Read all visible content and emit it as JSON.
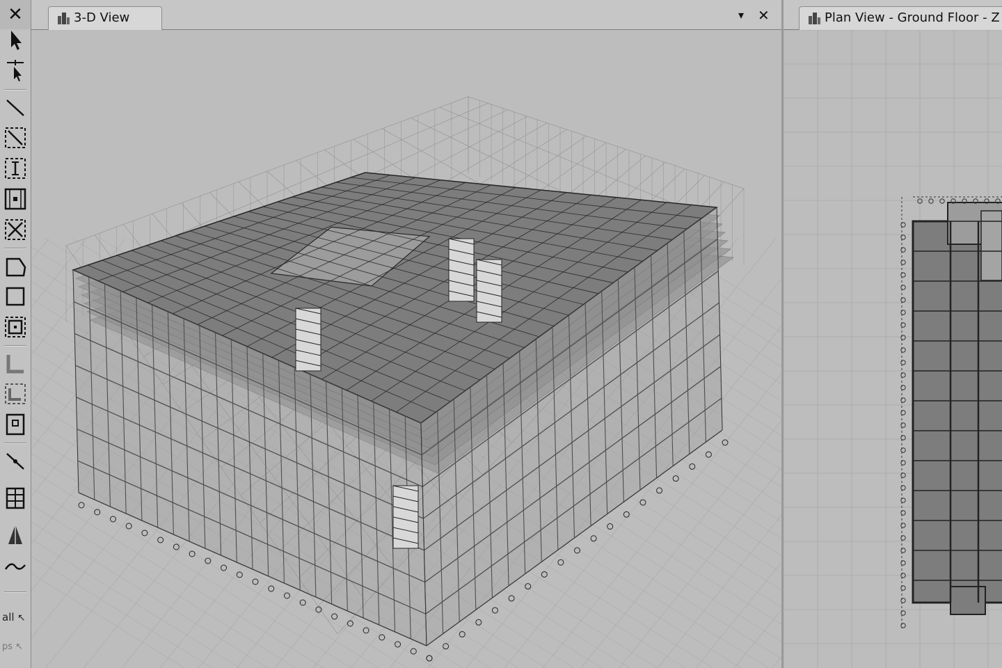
{
  "toolbar": {
    "close_glyph": "✕",
    "tools": [
      {
        "name": "pointer-icon"
      },
      {
        "name": "reshape-pointer-icon"
      },
      {
        "name": "draw-line-icon"
      },
      {
        "name": "draw-beam-icon"
      },
      {
        "name": "draw-column-icon"
      },
      {
        "name": "draw-brace-icon"
      },
      {
        "name": "draw-cross-brace-icon"
      },
      {
        "name": "draw-floor-polygon-icon"
      },
      {
        "name": "draw-rectangle-area-icon"
      },
      {
        "name": "quick-draw-area-icon"
      },
      {
        "name": "draw-wall-icon"
      },
      {
        "name": "quick-draw-wall-icon"
      },
      {
        "name": "draw-opening-icon"
      },
      {
        "name": "draw-link-icon"
      },
      {
        "name": "draw-grid-icon"
      },
      {
        "name": "draw-tendon-icon"
      },
      {
        "name": "draw-wave-icon"
      }
    ],
    "select_all_label": "all",
    "previous_selection_label": "ps"
  },
  "view_3d": {
    "tab_title": "3-D View",
    "dropdown_glyph": "▾",
    "close_glyph": "✕"
  },
  "plan_view": {
    "tab_title": "Plan View - Ground Floor - Z"
  },
  "colors": {
    "background": "#bdbdbd",
    "slab_fill": "#7d7d7d",
    "frame_line": "#262626",
    "grid_line": "#9e9e9e"
  }
}
